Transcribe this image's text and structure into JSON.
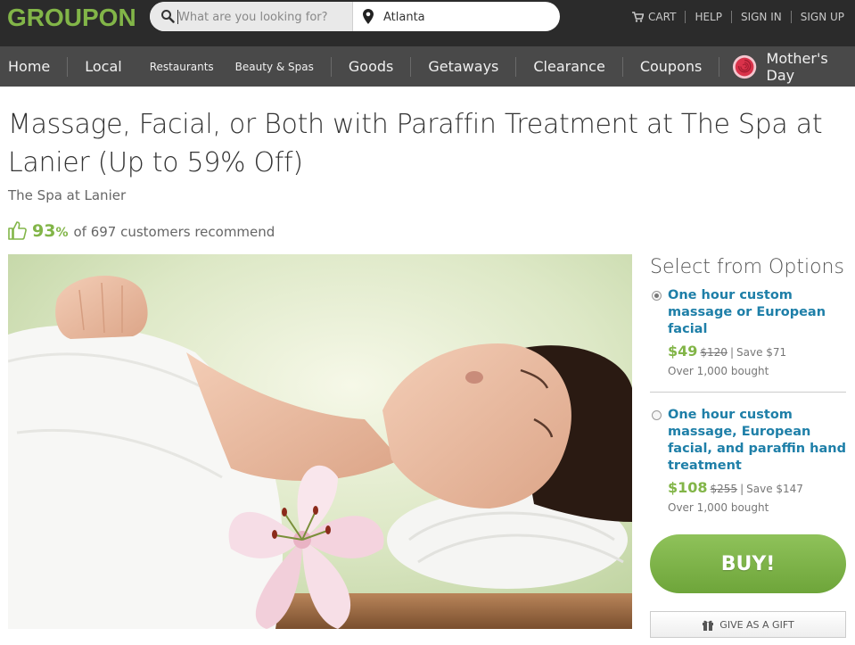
{
  "header": {
    "logo": "GROUPON",
    "search": {
      "placeholder": "What are you looking for?",
      "value": ""
    },
    "location": {
      "value": "Atlanta"
    },
    "links": {
      "cart": "CART",
      "help": "HELP",
      "sign_in": "SIGN IN",
      "sign_up": "SIGN UP"
    }
  },
  "nav": {
    "home": "Home",
    "local": "Local",
    "restaurants": "Restaurants",
    "beauty": "Beauty & Spas",
    "goods": "Goods",
    "getaways": "Getaways",
    "clearance": "Clearance",
    "coupons": "Coupons",
    "mothers_day": "Mother's Day"
  },
  "deal": {
    "title": "Massage, Facial, or Both with Paraffin Treatment at The Spa at Lanier (Up to 59% Off)",
    "merchant": "The Spa at Lanier",
    "recommend": {
      "pct": "93",
      "pct_sign": "%",
      "text": "of 697 customers recommend"
    }
  },
  "options": {
    "heading": "Select from Options",
    "items": [
      {
        "title": "One hour custom massage or European facial",
        "price": "$49",
        "original": "$120",
        "sep": "|",
        "save": "Save $71",
        "bought": "Over 1,000 bought",
        "selected": true
      },
      {
        "title": "One hour custom massage, European facial, and paraffin hand treatment",
        "price": "$108",
        "original": "$255",
        "sep": "|",
        "save": "Save $147",
        "bought": "Over 1,000 bought",
        "selected": false
      }
    ]
  },
  "actions": {
    "buy": "BUY!",
    "gift": "GIVE AS A GIFT"
  },
  "colors": {
    "brand_green": "#82b548",
    "link_blue": "#1e7fa8",
    "topbar": "#2b2b2b",
    "navbar": "#494949"
  }
}
